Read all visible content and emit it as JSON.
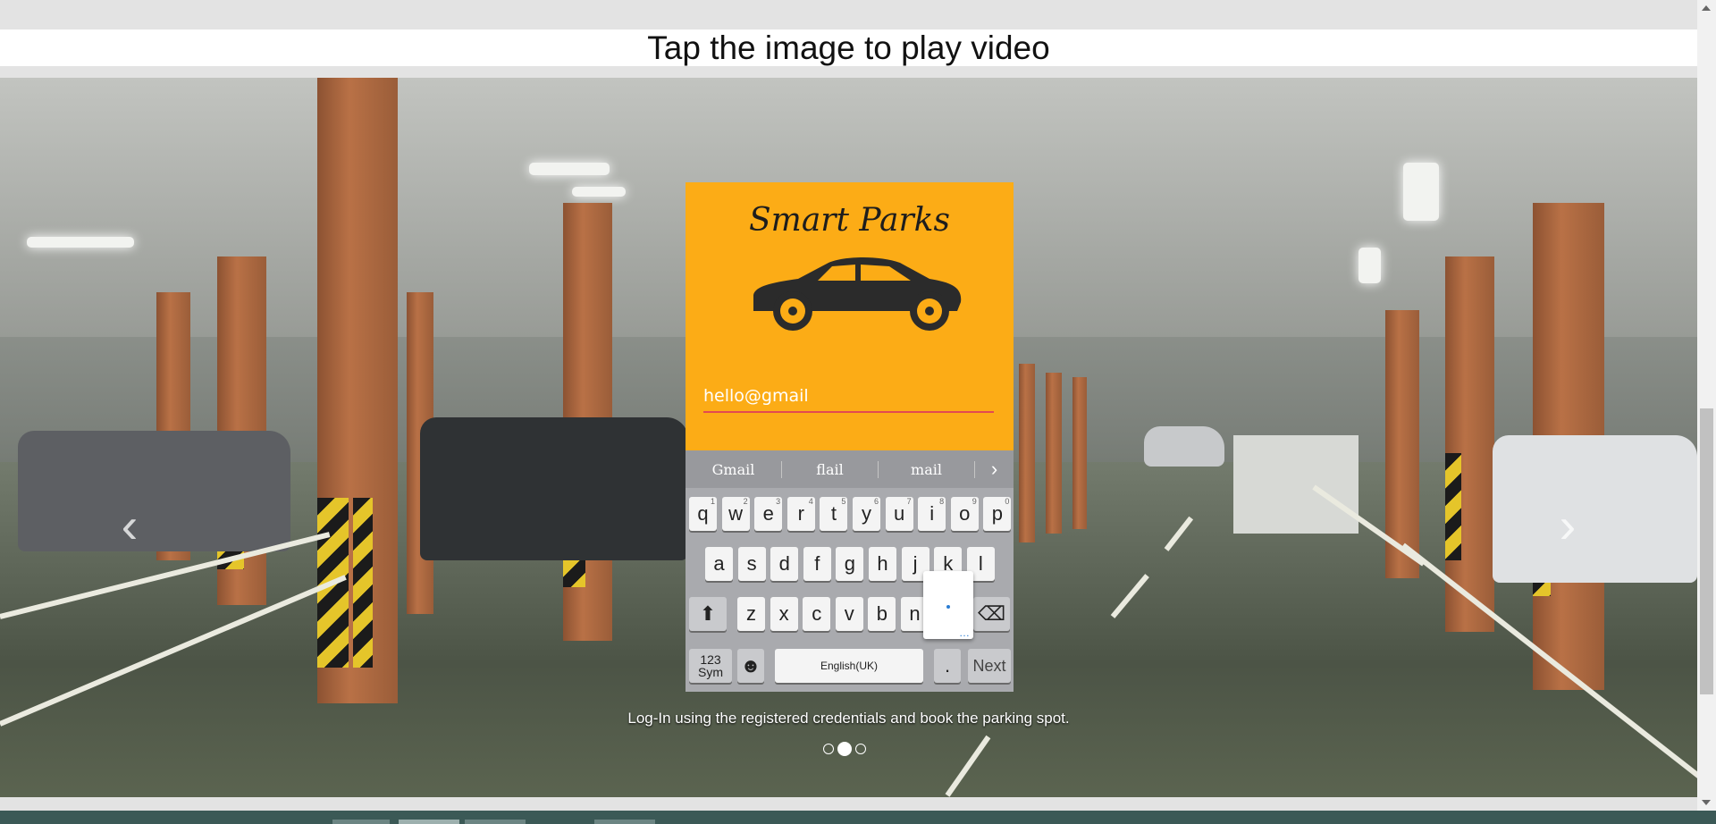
{
  "page": {
    "heading": "Tap the image to play video"
  },
  "carousel": {
    "prev_icon": "chevron-left-icon",
    "next_icon": "chevron-right-icon",
    "prev_glyph": "‹",
    "next_glyph": "›",
    "caption": "Log-In using the registered credentials and book the parking spot.",
    "indicators": [
      {
        "active": false
      },
      {
        "active": true
      },
      {
        "active": false
      }
    ],
    "active_index": 2,
    "slide_count": 3
  },
  "phone": {
    "app_name": "Smart Parks",
    "accent_color": "#fcac16",
    "email_value": "hello@gmail",
    "suggestions": [
      "Gmail",
      "flail",
      "mail"
    ],
    "suggestion_more": "›",
    "keyboard": {
      "row1": [
        {
          "k": "q",
          "h": "1"
        },
        {
          "k": "w",
          "h": "2"
        },
        {
          "k": "e",
          "h": "3"
        },
        {
          "k": "r",
          "h": "4"
        },
        {
          "k": "t",
          "h": "5"
        },
        {
          "k": "y",
          "h": "6"
        },
        {
          "k": "u",
          "h": "7"
        },
        {
          "k": "i",
          "h": "8"
        },
        {
          "k": "o",
          "h": "9"
        },
        {
          "k": "p",
          "h": "0"
        }
      ],
      "row2": [
        "a",
        "s",
        "d",
        "f",
        "g",
        "h",
        "j",
        "k",
        "l"
      ],
      "row3": [
        "z",
        "x",
        "c",
        "v",
        "b",
        "n"
      ],
      "sym_label": "123\nSym",
      "space_label": "English(UK)",
      "period_label": ".",
      "next_label": "Next",
      "shift_glyph": "⬆",
      "backspace_glyph": "⌫",
      "emoji_glyph": "☻"
    }
  },
  "colors": {
    "email_underline": "#e24a52",
    "taskbar": "#3b5956"
  }
}
